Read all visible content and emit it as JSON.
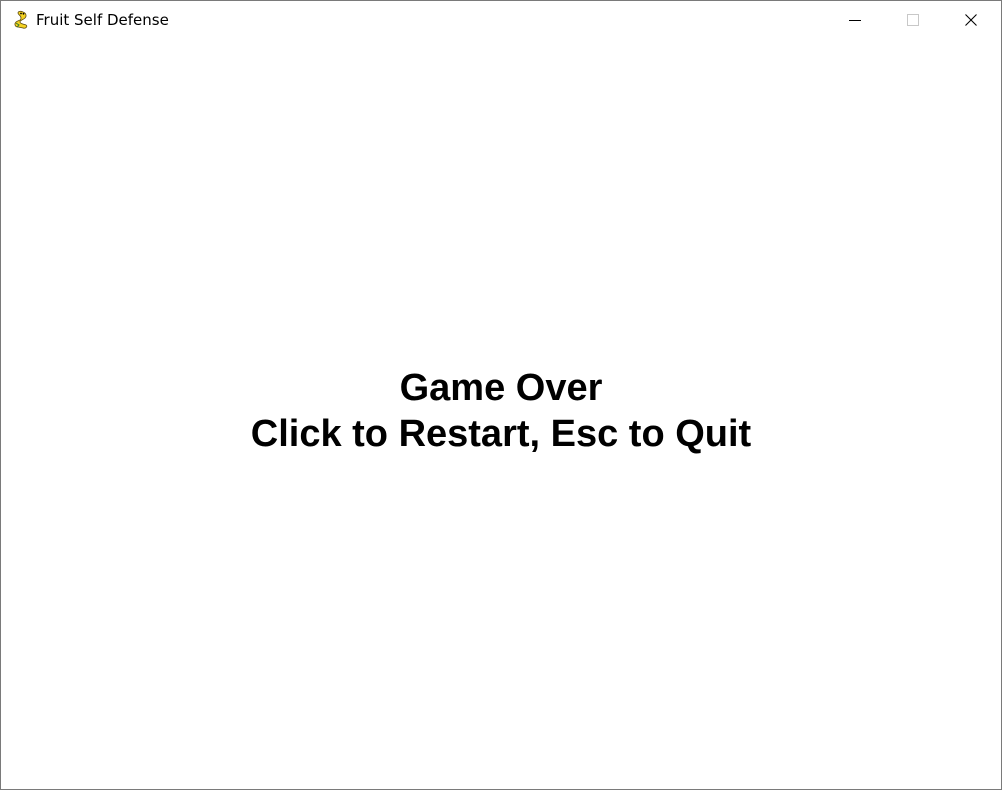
{
  "window": {
    "title": "Fruit Self Defense",
    "app_icon": "pygame-snake-icon",
    "controls": [
      "minimize-icon",
      "maximize-icon",
      "close-icon"
    ]
  },
  "game": {
    "background_color": "#ffffff",
    "text_color": "#000000",
    "game_over_text": "Game Over",
    "instruction_text": "Click to Restart, Esc to Quit"
  }
}
